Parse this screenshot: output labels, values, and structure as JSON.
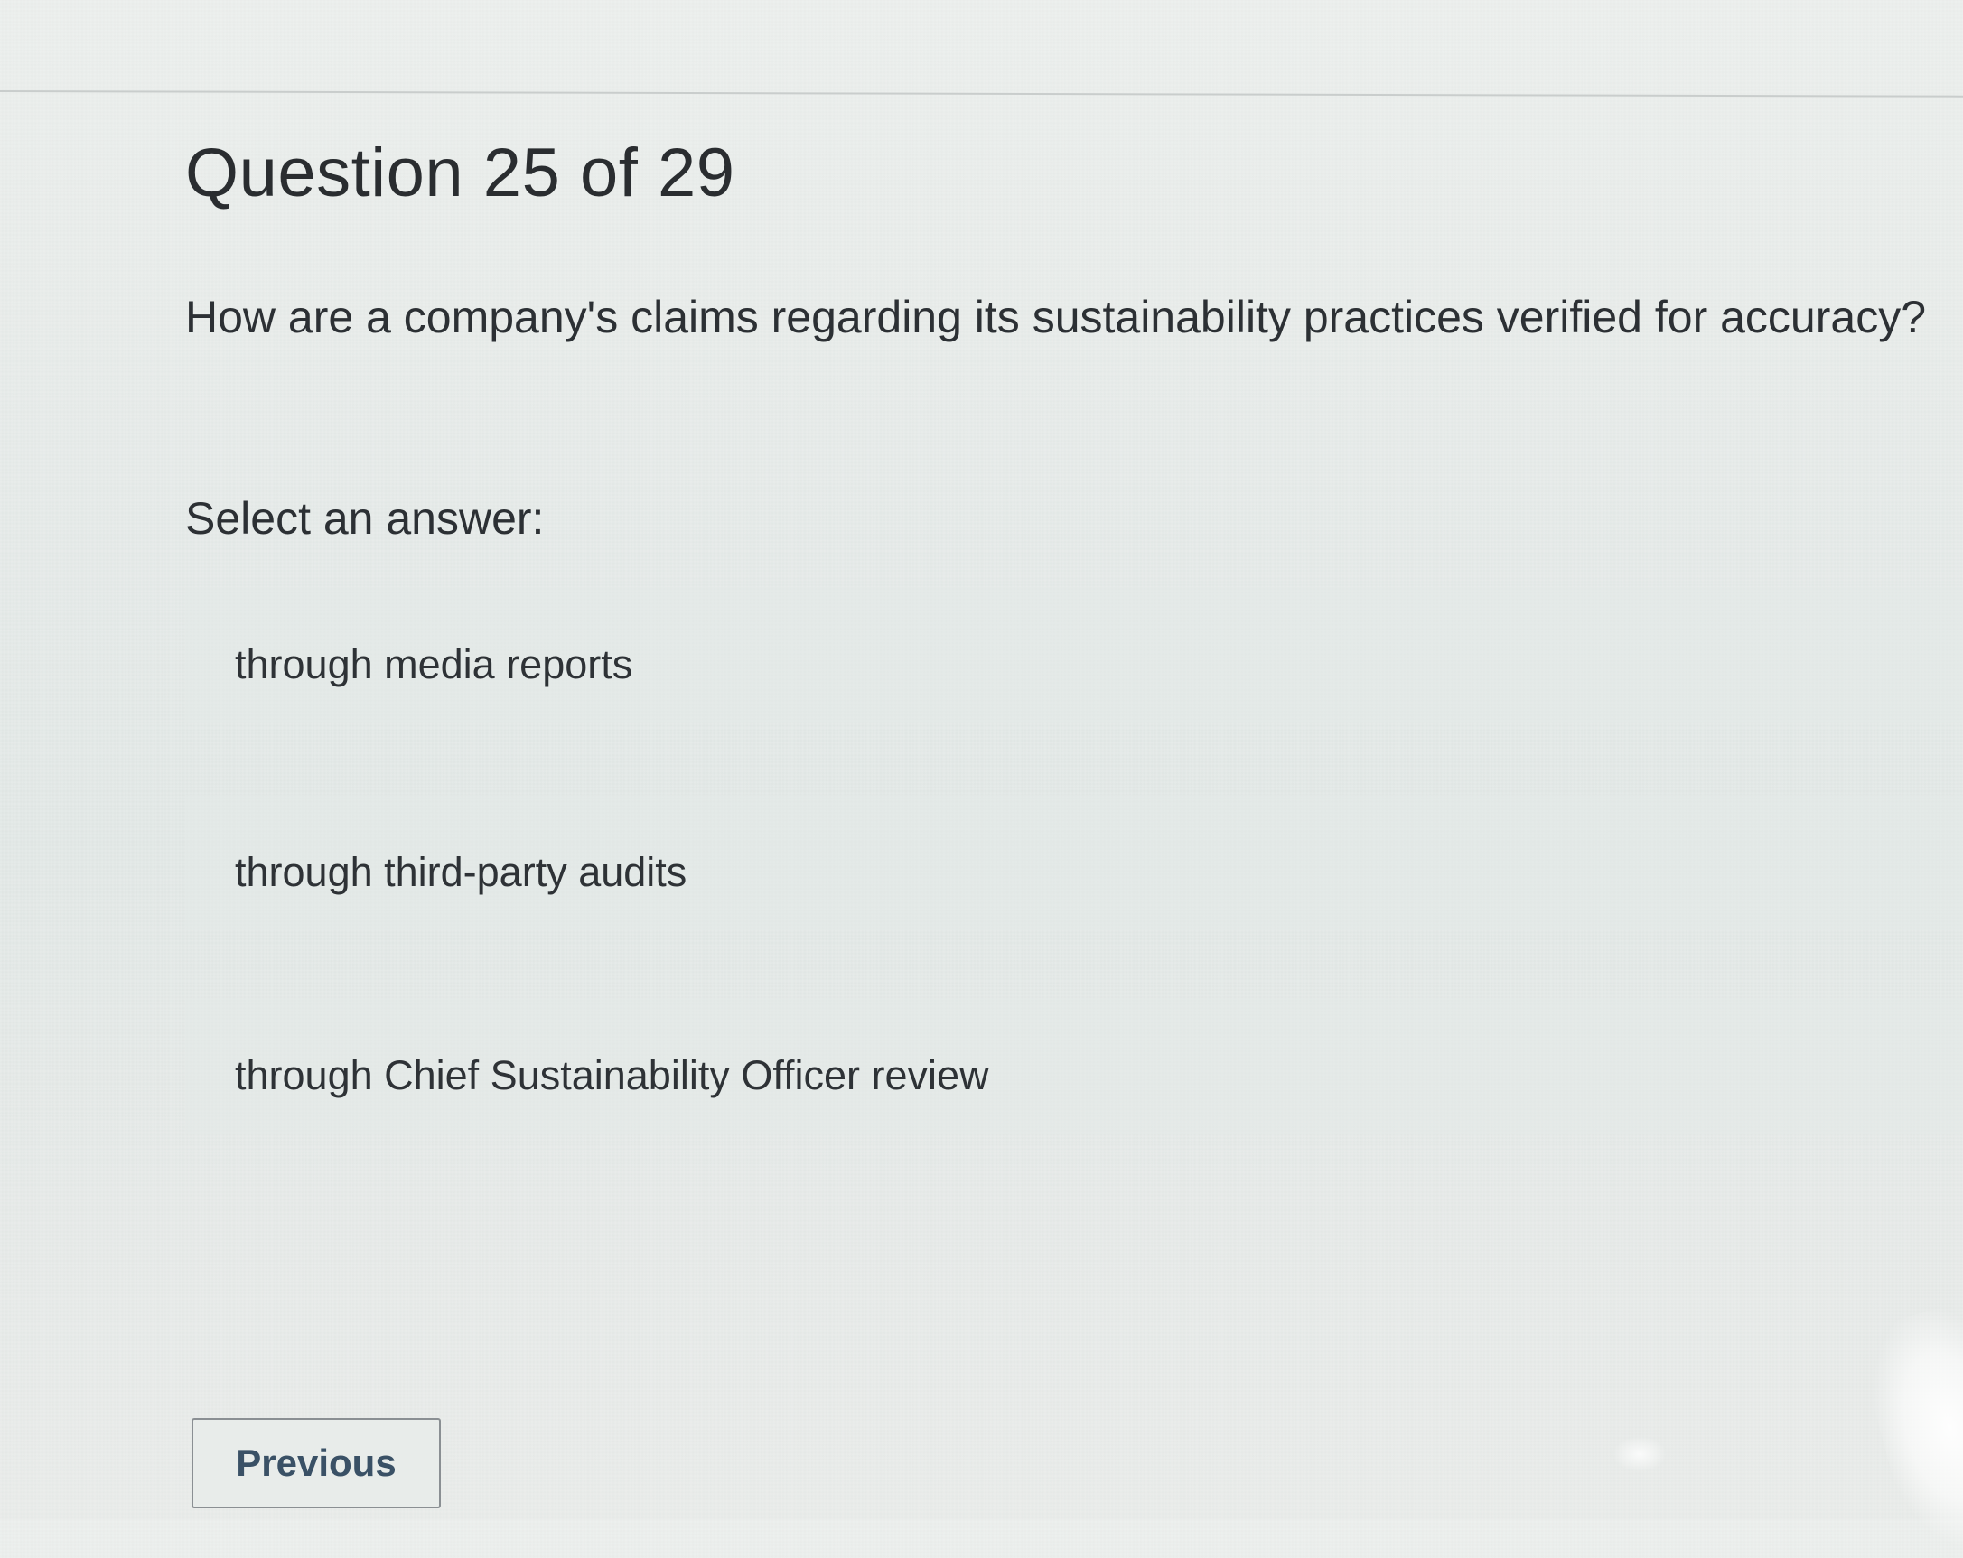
{
  "question": {
    "heading": "Question 25 of 29",
    "text": "How are a company's claims regarding its sustainability practices verified for accuracy?"
  },
  "answers": {
    "prompt": "Select an answer:",
    "options": [
      {
        "label": "through media reports"
      },
      {
        "label": "through third-party audits"
      },
      {
        "label": "through Chief Sustainability Officer review"
      }
    ]
  },
  "navigation": {
    "previous_label": "Previous"
  }
}
